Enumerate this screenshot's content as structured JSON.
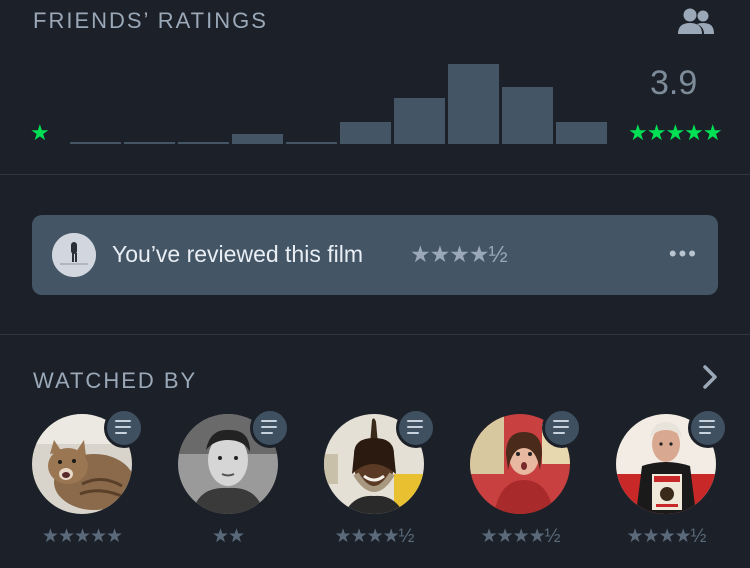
{
  "friends_ratings": {
    "title": "FRIENDS’ RATINGS",
    "average": "3.9",
    "min_star": "★",
    "max_stars": "★★★★★",
    "histogram": [
      0,
      0,
      0,
      0.13,
      0,
      0.28,
      0.57,
      1.0,
      0.71,
      0.28
    ]
  },
  "review_banner": {
    "text": "You’ve reviewed this film",
    "stars": "★★★★½",
    "more": "•••"
  },
  "watched_by": {
    "title": "WATCHED BY",
    "friends": [
      {
        "stars": "★★★★★",
        "avatar": "cat"
      },
      {
        "stars": "★★",
        "avatar": "man-bw"
      },
      {
        "stars": "★★★★½",
        "avatar": "dreadlocks"
      },
      {
        "stars": "★★★★½",
        "avatar": "woman-red"
      },
      {
        "stars": "★★★★½",
        "avatar": "man-sign"
      }
    ]
  },
  "colors": {
    "background": "#1c2028",
    "bar": "#445566",
    "accent_green": "#00e054",
    "banner": "#445566"
  }
}
